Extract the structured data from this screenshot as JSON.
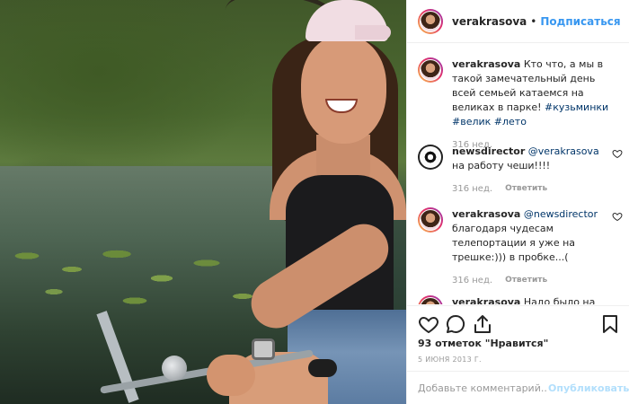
{
  "header": {
    "username": "verakrasova",
    "dot": "•",
    "follow_label": "Подписаться"
  },
  "comments": [
    {
      "username": "verakrasova",
      "text": "Кто что, а мы в такой замечательный день всей семьей катаемся на великах в парке!",
      "tags": "#кузьминки #велик #лето",
      "time": "316 нед.",
      "avatar": "vera-avatar"
    },
    {
      "username": "newsdirector",
      "mention": "@verakrasova",
      "text": "на работу чеши!!!!",
      "time": "316 нед.",
      "reply_label": "Ответить",
      "avatar": "newsdirector-avatar"
    },
    {
      "username": "verakrasova",
      "mention": "@newsdirector",
      "text": "благодаря чудесам телепортации я уже на трешке:))) в пробке...(",
      "time": "316 нед.",
      "reply_label": "Ответить",
      "avatar": "vera-avatar"
    },
    {
      "username": "verakrasova",
      "text": "Надо было на",
      "avatar": "vera-avatar"
    }
  ],
  "footer": {
    "likes": "93 отметок \"Нравится\"",
    "date": "5 ИЮНЯ 2013 Г.",
    "comment_placeholder": "Добавьте комментарий...",
    "post_label": "Опубликовать"
  },
  "icons": [
    "heart-icon",
    "comment-icon",
    "share-icon",
    "bookmark-icon"
  ],
  "colors": {
    "link": "#3897f0",
    "hashtag": "#003569",
    "muted": "#999999",
    "post_disabled": "#b2dffc"
  }
}
